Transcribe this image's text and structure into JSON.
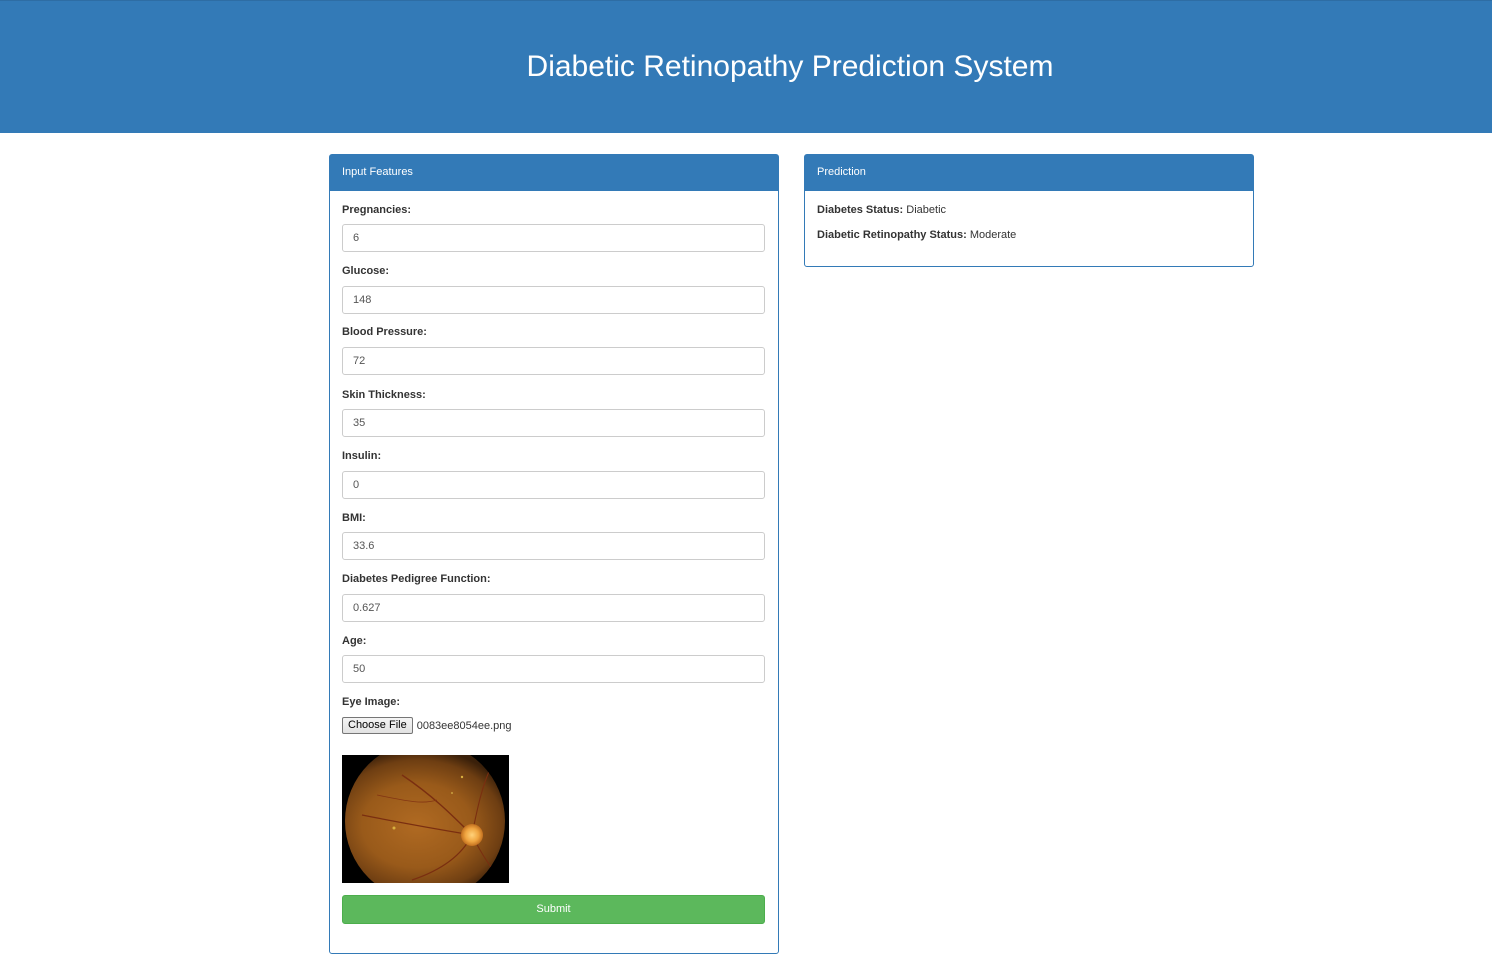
{
  "header": {
    "title": "Diabetic Retinopathy Prediction System"
  },
  "input_panel": {
    "heading": "Input Features",
    "fields": [
      {
        "label": "Pregnancies:",
        "value": "6"
      },
      {
        "label": "Glucose:",
        "value": "148"
      },
      {
        "label": "Blood Pressure:",
        "value": "72"
      },
      {
        "label": "Skin Thickness:",
        "value": "35"
      },
      {
        "label": "Insulin:",
        "value": "0"
      },
      {
        "label": "BMI:",
        "value": "33.6"
      },
      {
        "label": "Diabetes Pedigree Function:",
        "value": "0.627"
      },
      {
        "label": "Age:",
        "value": "50"
      }
    ],
    "eye_image": {
      "label": "Eye Image:",
      "choose_button": "Choose File",
      "file_name": "0083ee8054ee.png"
    },
    "submit_label": "Submit"
  },
  "prediction_panel": {
    "heading": "Prediction",
    "diabetes_status_label": "Diabetes Status:",
    "diabetes_status_value": "Diabetic",
    "retinopathy_status_label": "Diabetic Retinopathy Status:",
    "retinopathy_status_value": "Moderate"
  },
  "colors": {
    "primary": "#337ab7",
    "success": "#5cb85c"
  }
}
